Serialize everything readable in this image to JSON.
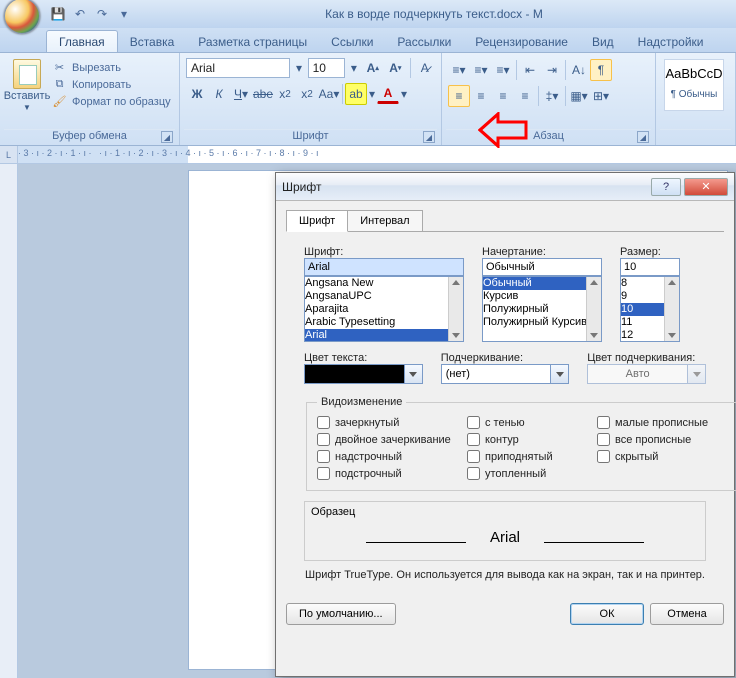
{
  "title": "Как в ворде подчеркнуть текст.docx - M",
  "tabs": [
    "Главная",
    "Вставка",
    "Разметка страницы",
    "Ссылки",
    "Рассылки",
    "Рецензирование",
    "Вид",
    "Надстройки"
  ],
  "qat": {
    "save": "💾",
    "undo": "↶",
    "redo": "↷",
    "more": "▾"
  },
  "clipboard": {
    "paste": "Вставить",
    "cut": "Вырезать",
    "copy": "Копировать",
    "format": "Формат по образцу",
    "group": "Буфер обмена"
  },
  "font": {
    "name": "Arial",
    "size": "10",
    "group": "Шрифт"
  },
  "para": {
    "group": "Абзац"
  },
  "styles": {
    "preview": "AaBbCcD",
    "name": "¶ Обычны"
  },
  "ruler": "· 3 · ı · 2 · ı · 1 · ı ·   · ı · 1 · ı · 2 · ı · 3 · ı · 4 · ı · 5 · ı · 6 · ı · 7 · ı · 8 · ı · 9 · ı",
  "dialog": {
    "title": "Шрифт",
    "tab1": "Шрифт",
    "tab2": "Интервал",
    "fontLabel": "Шрифт:",
    "fontValue": "Arial",
    "fontList": [
      "Angsana New",
      "AngsanaUPC",
      "Aparajita",
      "Arabic Typesetting",
      "Arial"
    ],
    "styleLabel": "Начертание:",
    "styleValue": "Обычный",
    "styleList": [
      "Обычный",
      "Курсив",
      "Полужирный",
      "Полужирный Курсив"
    ],
    "sizeLabel": "Размер:",
    "sizeValue": "10",
    "sizeList": [
      "8",
      "9",
      "10",
      "11",
      "12"
    ],
    "colorLabel": "Цвет текста:",
    "underlineLabel": "Подчеркивание:",
    "underlineValue": "(нет)",
    "ucolorLabel": "Цвет подчеркивания:",
    "ucolorValue": "Авто",
    "effectsTitle": "Видоизменение",
    "effects": [
      "зачеркнутый",
      "с тенью",
      "малые прописные",
      "двойное зачеркивание",
      "контур",
      "все прописные",
      "надстрочный",
      "приподнятый",
      "скрытый",
      "подстрочный",
      "утопленный"
    ],
    "sampleLabel": "Образец",
    "sampleText": "Arial",
    "info": "Шрифт TrueType. Он используется для вывода как на экран, так и на принтер.",
    "default": "По умолчанию...",
    "ok": "ОК",
    "cancel": "Отмена"
  }
}
